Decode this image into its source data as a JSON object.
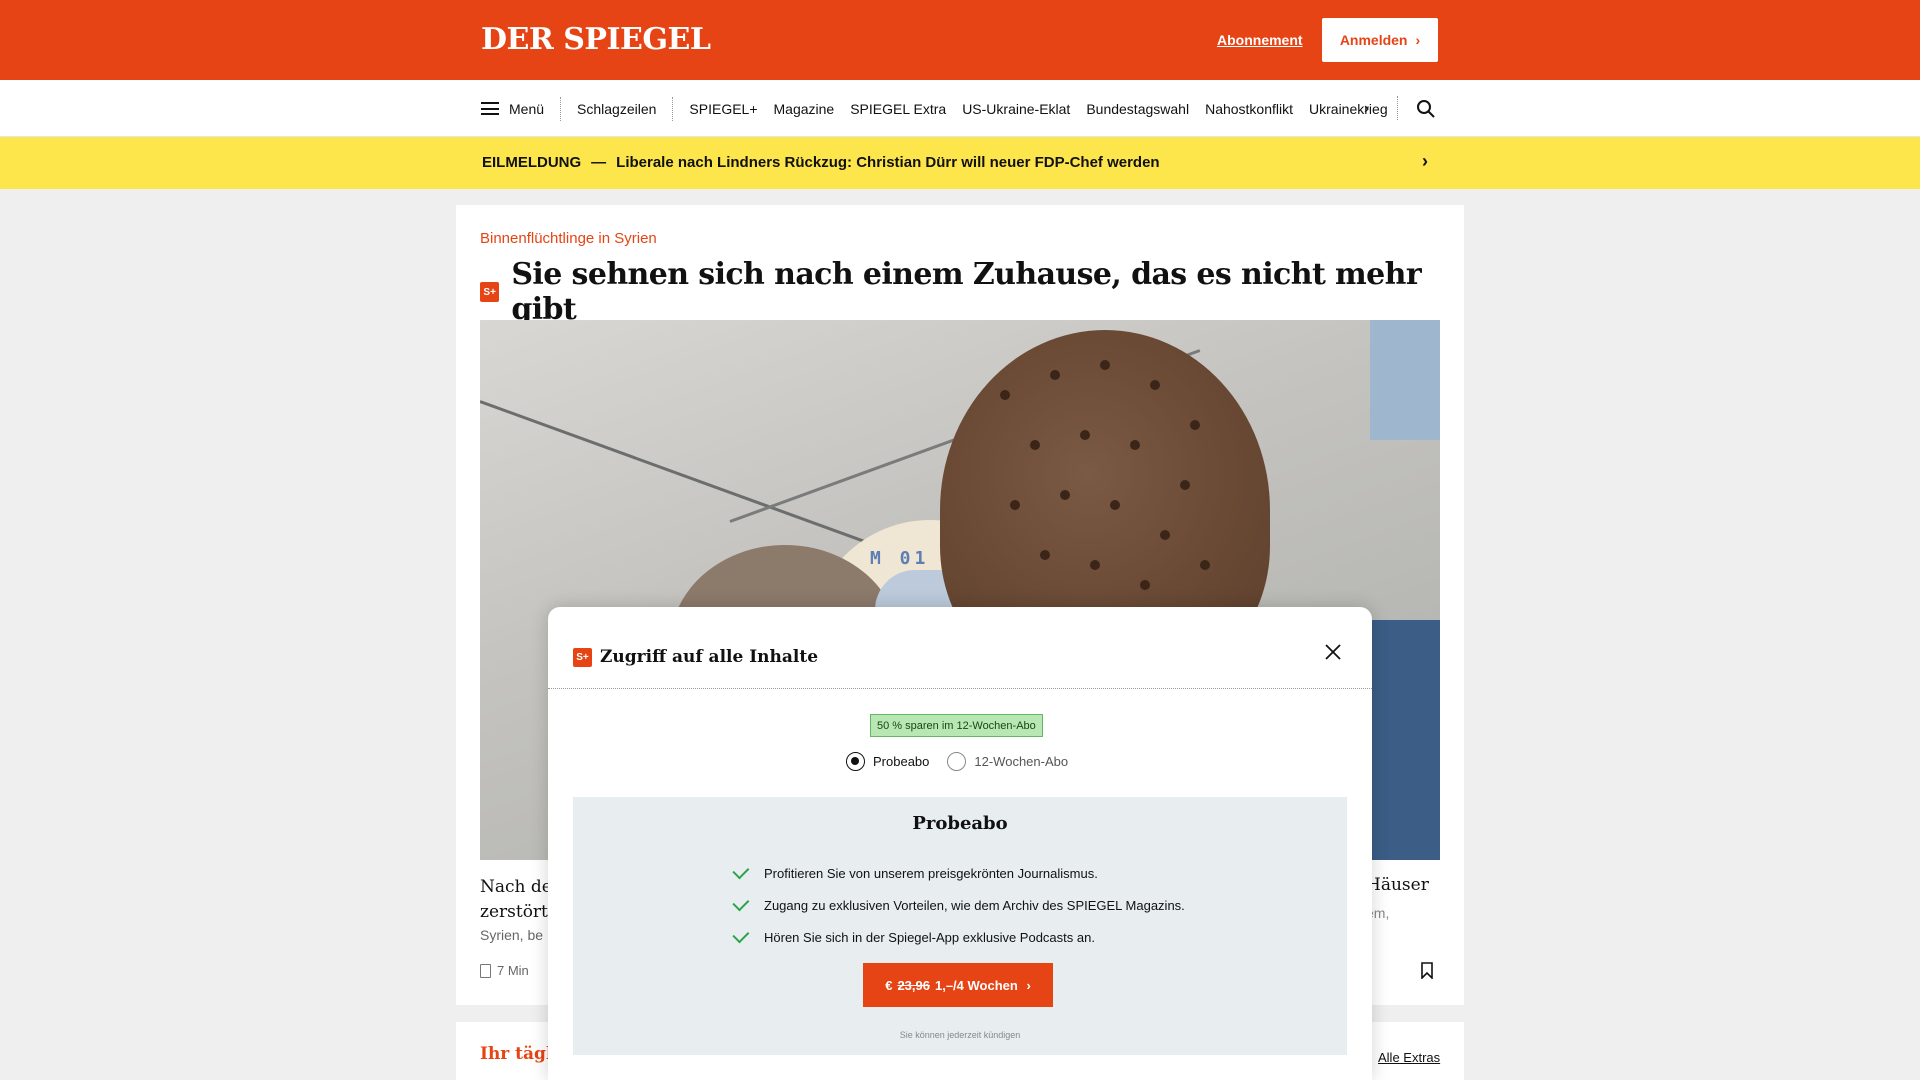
{
  "header": {
    "logo": "DER SPIEGEL",
    "abo_label": "Abonnement",
    "login_label": "Anmelden",
    "brand_color": "#e64415"
  },
  "nav": {
    "menu_label": "Menü",
    "items": [
      "Schlagzeilen",
      "SPIEGEL+",
      "Magazine",
      "SPIEGEL Extra",
      "US-Ukraine-Eklat",
      "Bundestagswahl",
      "Nahostkonflikt",
      "Ukrainekrieg"
    ],
    "more_icon": "chevron-right-icon",
    "search_icon": "search-icon"
  },
  "breaking": {
    "label": "EILMELDUNG",
    "dash": "—",
    "text": "Liberale nach Lindners Rückzug: Christian Dürr will neuer FDP-Chef werden",
    "background": "#fde64b"
  },
  "article": {
    "kicker": "Binnenflüchtlinge in Syrien",
    "badge": "S+",
    "headline": "Sie sehnen sich nach einem Zuhause, das es nicht mehr gibt",
    "photo_sign": "M 01",
    "teaser_left_line1": "Nach der",
    "teaser_left_line2": "zerstört",
    "teaser_left_meta": "Syrien, be",
    "teaser_right": "Häuser",
    "teaser_right_meta": "em,",
    "read_time": "7 Min"
  },
  "section2": {
    "title": "Ihr täglic",
    "all_extras": "Alle Extras"
  },
  "modal": {
    "badge": "S+",
    "title": "Zugriff auf alle Inhalte",
    "save_badge": "50 % sparen im 12-Wochen-Abo",
    "options": [
      {
        "label": "Probeabo",
        "selected": true
      },
      {
        "label": "12-Wochen-Abo",
        "selected": false
      }
    ],
    "offer": {
      "title": "Probeabo",
      "features": [
        "Profitieren Sie von unserem preisgekrönten Journalismus.",
        "Zugang zu exklusiven Vorteilen, wie dem Archiv des SPIEGEL Magazins.",
        "Hören Sie sich in der Spiegel-App exklusive Podcasts an."
      ],
      "cta_prefix": "€",
      "cta_old_price": "23,96",
      "cta_new_price": "1,–/4 Wochen",
      "cancel_note": "Sie können jederzeit kündigen"
    }
  }
}
